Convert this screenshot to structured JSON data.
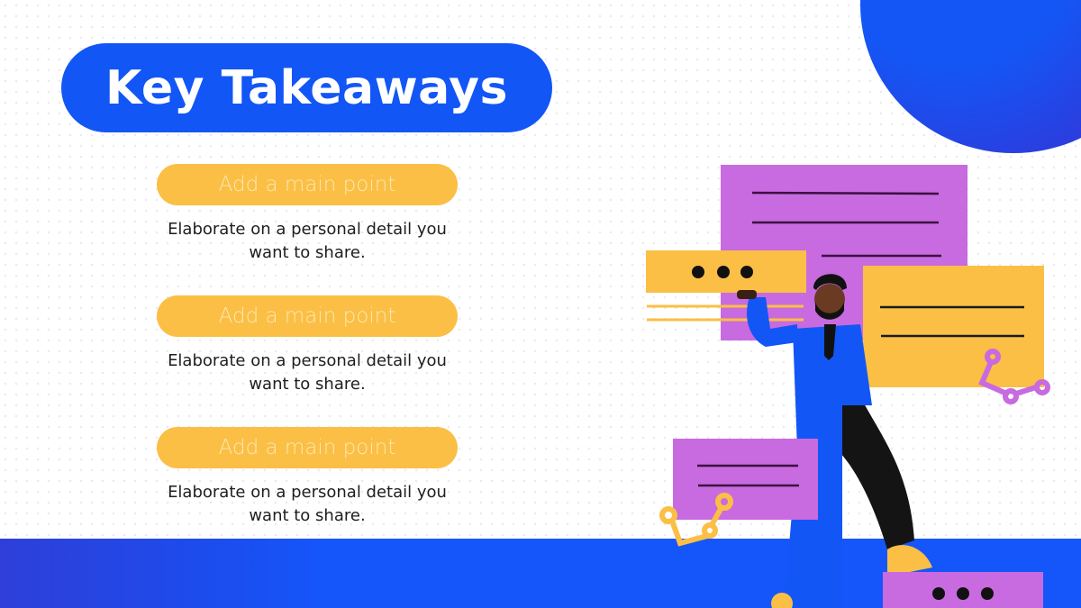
{
  "slide": {
    "title": "Key Takeaways",
    "points": [
      {
        "heading": "Add a main point",
        "description": "Elaborate on a personal detail you want to share."
      },
      {
        "heading": "Add a main point",
        "description": "Elaborate on a personal detail you want to share."
      },
      {
        "heading": "Add a main point",
        "description": "Elaborate on a personal detail you want to share."
      }
    ]
  },
  "colors": {
    "blue": "#1356f6",
    "yellow": "#fbbf45",
    "purple": "#c86ae0",
    "dark": "#1a1a1a"
  },
  "illustration": {
    "subject": "man-in-blue-suit-with-chat-windows",
    "icons": [
      "ellipsis-window-icon",
      "text-window-icon",
      "connector-node-icon"
    ]
  }
}
